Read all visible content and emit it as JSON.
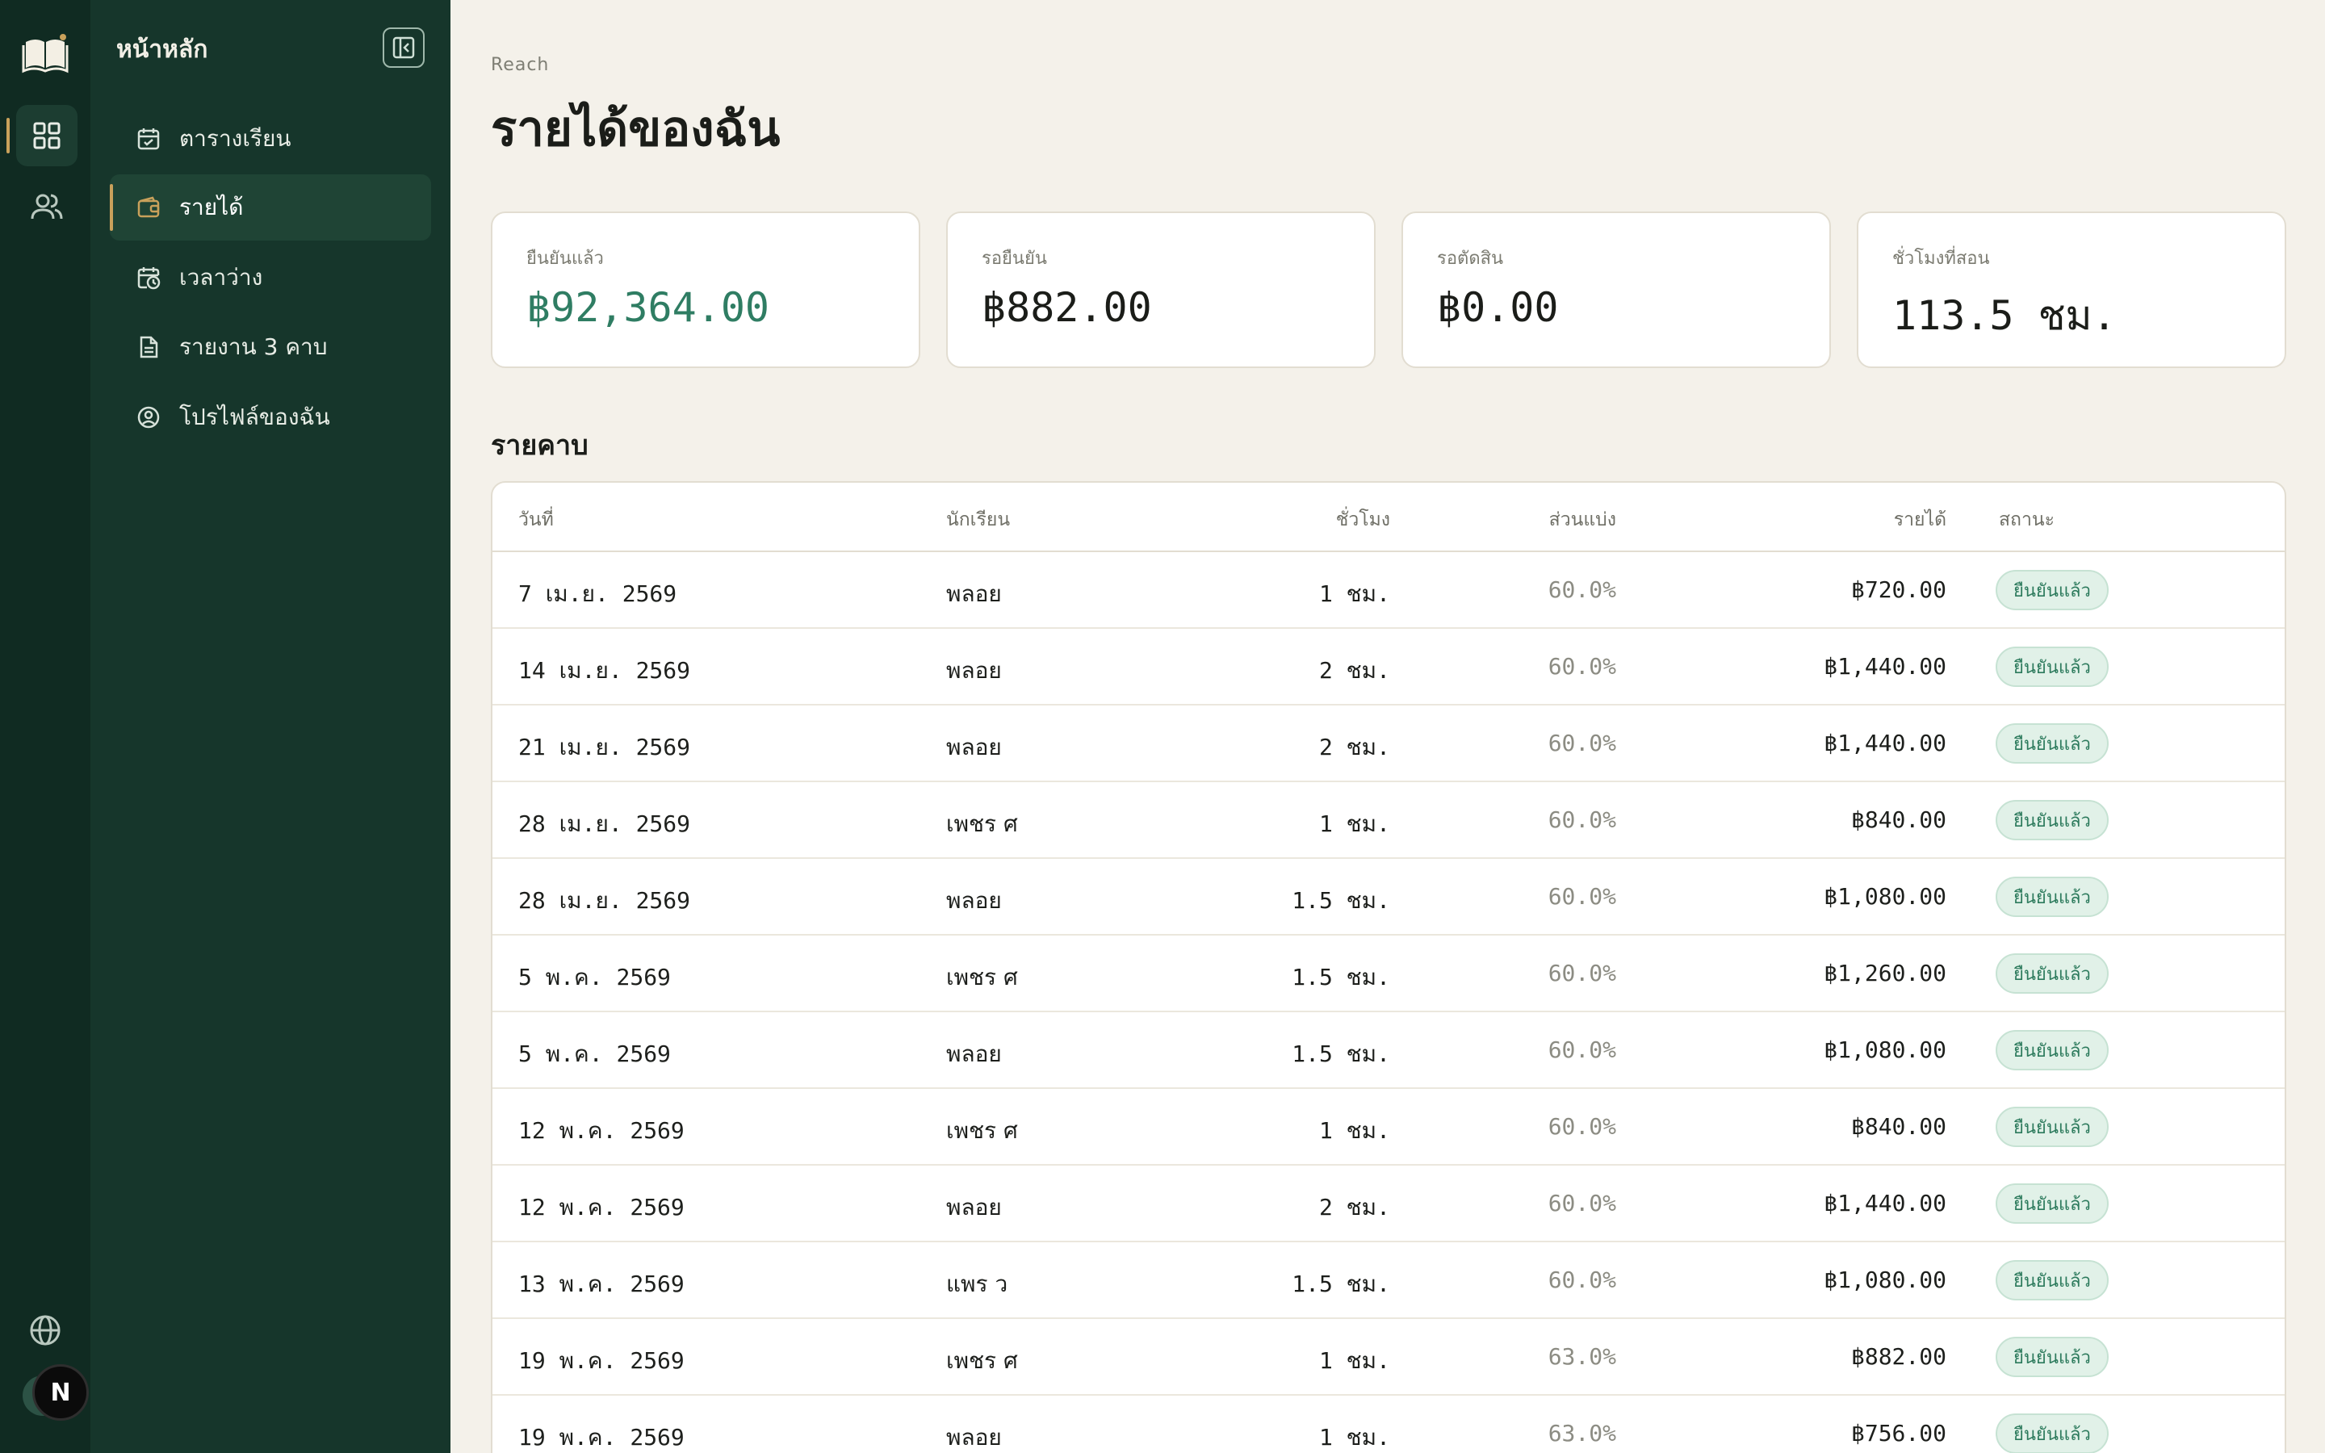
{
  "rail": {
    "logo_icon": "open-book-icon",
    "items": [
      {
        "icon": "dashboard-grid-icon",
        "active": true
      },
      {
        "icon": "users-icon",
        "active": false
      }
    ],
    "bottom": [
      {
        "icon": "globe-icon"
      }
    ],
    "avatar_letter": "N"
  },
  "sidebar": {
    "title": "หน้าหลัก",
    "collapse_icon": "panel-collapse-icon",
    "items": [
      {
        "label": "ตารางเรียน",
        "icon": "calendar-check-icon",
        "active": false
      },
      {
        "label": "รายได้",
        "icon": "wallet-icon",
        "active": true
      },
      {
        "label": "เวลาว่าง",
        "icon": "calendar-clock-icon",
        "active": false
      },
      {
        "label": "รายงาน 3 คาบ",
        "icon": "document-icon",
        "active": false
      },
      {
        "label": "โปรไฟล์ของฉัน",
        "icon": "user-circle-icon",
        "active": false
      }
    ]
  },
  "main": {
    "breadcrumb": "Reach",
    "title": "รายได้ของฉัน",
    "cards": [
      {
        "label": "ยืนยันแล้ว",
        "value": "฿92,364.00",
        "accent": "#2f7d63"
      },
      {
        "label": "รอยืนยัน",
        "value": "฿882.00"
      },
      {
        "label": "รอตัดสิน",
        "value": "฿0.00"
      },
      {
        "label": "ชั่วโมงที่สอน",
        "value": "113.5 ชม."
      }
    ],
    "section_title": "รายคาบ",
    "table": {
      "headers": {
        "date": "วันที่",
        "student": "นักเรียน",
        "hours": "ชั่วโมง",
        "share": "ส่วนแบ่ง",
        "income": "รายได้",
        "status": "สถานะ"
      },
      "rows": [
        {
          "date": "7 เม.ย. 2569",
          "student": "พลอย",
          "hours": "1 ชม.",
          "share": "60.0%",
          "income": "฿720.00",
          "status": "ยืนยันแล้ว"
        },
        {
          "date": "14 เม.ย. 2569",
          "student": "พลอย",
          "hours": "2 ชม.",
          "share": "60.0%",
          "income": "฿1,440.00",
          "status": "ยืนยันแล้ว"
        },
        {
          "date": "21 เม.ย. 2569",
          "student": "พลอย",
          "hours": "2 ชม.",
          "share": "60.0%",
          "income": "฿1,440.00",
          "status": "ยืนยันแล้ว"
        },
        {
          "date": "28 เม.ย. 2569",
          "student": "เพชร ศ",
          "hours": "1 ชม.",
          "share": "60.0%",
          "income": "฿840.00",
          "status": "ยืนยันแล้ว"
        },
        {
          "date": "28 เม.ย. 2569",
          "student": "พลอย",
          "hours": "1.5 ชม.",
          "share": "60.0%",
          "income": "฿1,080.00",
          "status": "ยืนยันแล้ว"
        },
        {
          "date": "5 พ.ค. 2569",
          "student": "เพชร ศ",
          "hours": "1.5 ชม.",
          "share": "60.0%",
          "income": "฿1,260.00",
          "status": "ยืนยันแล้ว"
        },
        {
          "date": "5 พ.ค. 2569",
          "student": "พลอย",
          "hours": "1.5 ชม.",
          "share": "60.0%",
          "income": "฿1,080.00",
          "status": "ยืนยันแล้ว"
        },
        {
          "date": "12 พ.ค. 2569",
          "student": "เพชร ศ",
          "hours": "1 ชม.",
          "share": "60.0%",
          "income": "฿840.00",
          "status": "ยืนยันแล้ว"
        },
        {
          "date": "12 พ.ค. 2569",
          "student": "พลอย",
          "hours": "2 ชม.",
          "share": "60.0%",
          "income": "฿1,440.00",
          "status": "ยืนยันแล้ว"
        },
        {
          "date": "13 พ.ค. 2569",
          "student": "แพร ว",
          "hours": "1.5 ชม.",
          "share": "60.0%",
          "income": "฿1,080.00",
          "status": "ยืนยันแล้ว"
        },
        {
          "date": "19 พ.ค. 2569",
          "student": "เพชร ศ",
          "hours": "1 ชม.",
          "share": "63.0%",
          "income": "฿882.00",
          "status": "ยืนยันแล้ว"
        },
        {
          "date": "19 พ.ค. 2569",
          "student": "พลอย",
          "hours": "1 ชม.",
          "share": "63.0%",
          "income": "฿756.00",
          "status": "ยืนยันแล้ว"
        }
      ]
    }
  }
}
